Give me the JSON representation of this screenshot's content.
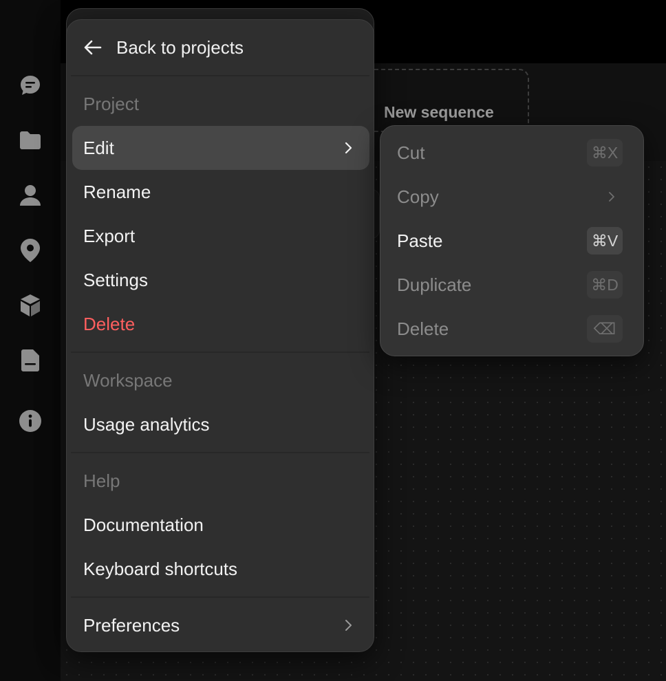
{
  "rail": {
    "icons": [
      "menu-icon",
      "chat-icon",
      "folder-icon",
      "person-icon",
      "location-pin-icon",
      "cube-icon",
      "document-icon",
      "info-icon"
    ]
  },
  "canvas": {
    "sequence_label": "New sequence"
  },
  "menu": {
    "back_label": "Back to projects",
    "sections": {
      "project": "Project",
      "workspace": "Workspace",
      "help": "Help"
    },
    "items": {
      "edit": "Edit",
      "rename": "Rename",
      "export": "Export",
      "settings": "Settings",
      "delete": "Delete",
      "usage_analytics": "Usage analytics",
      "documentation": "Documentation",
      "keyboard_shortcuts": "Keyboard shortcuts",
      "preferences": "Preferences"
    }
  },
  "submenu": {
    "items": [
      {
        "label": "Cut",
        "shortcut": "⌘X",
        "enabled": false
      },
      {
        "label": "Copy",
        "shortcut": "",
        "enabled": false
      },
      {
        "label": "Paste",
        "shortcut": "⌘V",
        "enabled": true
      },
      {
        "label": "Duplicate",
        "shortcut": "⌘D",
        "enabled": false
      },
      {
        "label": "Delete",
        "shortcut": "⌫",
        "enabled": false
      }
    ]
  },
  "colors": {
    "menu_bg": "#2f2f2f",
    "active_item_bg": "#474747",
    "danger": "#ff5f5f",
    "muted_text": "#777777"
  }
}
